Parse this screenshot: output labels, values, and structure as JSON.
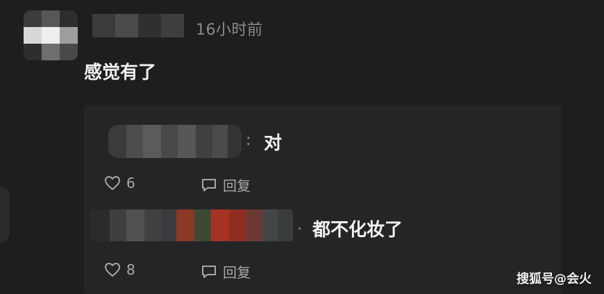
{
  "comment": {
    "time": "16小时前",
    "text": "感觉有了"
  },
  "replies": [
    {
      "separator": ":",
      "text": "对",
      "likes": "6",
      "reply_label": "回复"
    },
    {
      "separator": ".",
      "text": "都不化妆了",
      "likes": "8",
      "reply_label": "回复"
    }
  ],
  "watermark": "搜狐号@会火",
  "icons": {
    "like": "heart-outline-icon",
    "reply": "speech-bubble-icon"
  },
  "colors": {
    "background": "#1d1e20",
    "panel": "#242527",
    "muted_text": "#8a8b8d",
    "main_text": "#f2f2f2"
  }
}
